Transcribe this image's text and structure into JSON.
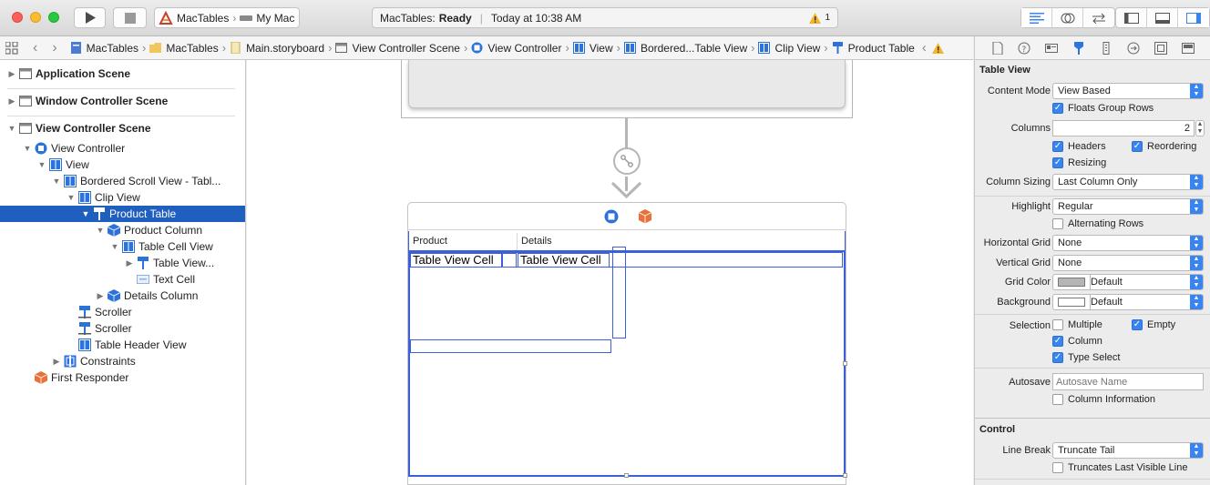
{
  "toolbar": {
    "scheme_target": "MacTables",
    "scheme_device": "My Mac",
    "activity_project": "MacTables:",
    "activity_status": "Ready",
    "activity_time": "Today at 10:38 AM",
    "warning_count": "1"
  },
  "jumpbar": {
    "items": [
      "MacTables",
      "MacTables",
      "Main.storyboard",
      "View Controller Scene",
      "View Controller",
      "View",
      "Bordered...Table View",
      "Clip View",
      "Product Table"
    ]
  },
  "outline": {
    "rows": [
      {
        "label": "Application Scene",
        "icon": "scene-icon"
      },
      {
        "label": "Window Controller Scene",
        "icon": "scene-icon"
      },
      {
        "label": "View Controller Scene",
        "icon": "scene-icon"
      },
      {
        "label": "View Controller",
        "icon": "view-controller-icon"
      },
      {
        "label": "View",
        "icon": "view-icon"
      },
      {
        "label": "Bordered Scroll View - Tabl...",
        "icon": "view-icon"
      },
      {
        "label": "Clip View",
        "icon": "view-icon"
      },
      {
        "label": "Product Table",
        "icon": "table-icon"
      },
      {
        "label": "Product Column",
        "icon": "cube-icon"
      },
      {
        "label": "Table Cell View",
        "icon": "view-icon"
      },
      {
        "label": "Table View...",
        "icon": "table-icon"
      },
      {
        "label": "Text Cell",
        "icon": "text-cell-icon"
      },
      {
        "label": "Details Column",
        "icon": "cube-icon"
      },
      {
        "label": "Scroller",
        "icon": "scroller-icon"
      },
      {
        "label": "Scroller",
        "icon": "scroller-icon"
      },
      {
        "label": "Table Header View",
        "icon": "view-icon"
      },
      {
        "label": "Constraints",
        "icon": "constraints-icon"
      },
      {
        "label": "First Responder",
        "icon": "first-responder-icon"
      }
    ]
  },
  "canvas": {
    "col_product": "Product",
    "col_details": "Details",
    "cell1": "Table View Cell",
    "cell2": "Table View Cell"
  },
  "inspector": {
    "table_view_title": "Table View",
    "content_mode_label": "Content Mode",
    "content_mode_value": "View Based",
    "floats_group_rows": "Floats Group Rows",
    "columns_label": "Columns",
    "columns_value": "2",
    "headers": "Headers",
    "reordering": "Reordering",
    "resizing": "Resizing",
    "column_sizing_label": "Column Sizing",
    "column_sizing_value": "Last Column Only",
    "highlight_label": "Highlight",
    "highlight_value": "Regular",
    "alternating_rows": "Alternating Rows",
    "horizontal_grid_label": "Horizontal Grid",
    "horizontal_grid_value": "None",
    "vertical_grid_label": "Vertical Grid",
    "vertical_grid_value": "None",
    "grid_color_label": "Grid Color",
    "grid_color_value": "Default",
    "background_label": "Background",
    "background_value": "Default",
    "selection_label": "Selection",
    "multiple": "Multiple",
    "empty": "Empty",
    "column": "Column",
    "type_select": "Type Select",
    "autosave_label": "Autosave",
    "autosave_placeholder": "Autosave Name",
    "column_information": "Column Information",
    "control_title": "Control",
    "line_break_label": "Line Break",
    "line_break_value": "Truncate Tail",
    "truncates_last_visible_line": "Truncates Last Visible Line"
  },
  "colors": {
    "accent": "#3a84f0",
    "selection": "#1f5fbf",
    "canvas_selection": "#3d5fd8"
  }
}
